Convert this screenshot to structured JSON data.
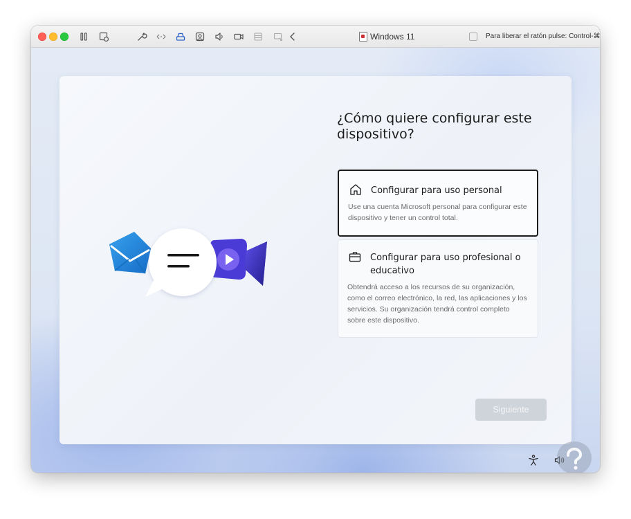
{
  "window": {
    "title": "Windows 11",
    "release_hint": "Para liberar el ratón pulse: Control-⌘"
  },
  "toolbar_icons": [
    "pause-icon",
    "snapshot-icon",
    "wrench-icon",
    "network-icon",
    "drive-icon",
    "user-icon",
    "speaker-icon",
    "camera-icon",
    "printer-icon",
    "display-icon",
    "chevron-left-icon"
  ],
  "oobe": {
    "heading": "¿Cómo quiere configurar este dispositivo?",
    "options": [
      {
        "title": "Configurar para uso personal",
        "description": "Use una cuenta Microsoft personal para configurar este dispositivo y tener un control total.",
        "icon": "home-icon",
        "selected": true
      },
      {
        "title": "Configurar para uso profesional o educativo",
        "description": "Obtendrá acceso a los recursos de su organización, como el correo electrónico, la red, las aplicaciones y los servicios. Su organización tendrá control completo sobre este dispositivo.",
        "icon": "briefcase-icon",
        "selected": false
      }
    ],
    "next_label": "Siguiente"
  },
  "colors": {
    "accent_selected_border": "#1c1c1c",
    "disabled_button": "#cfd3da",
    "mail_blue": "#1b86d8",
    "video_purple": "#4a3bd6"
  }
}
